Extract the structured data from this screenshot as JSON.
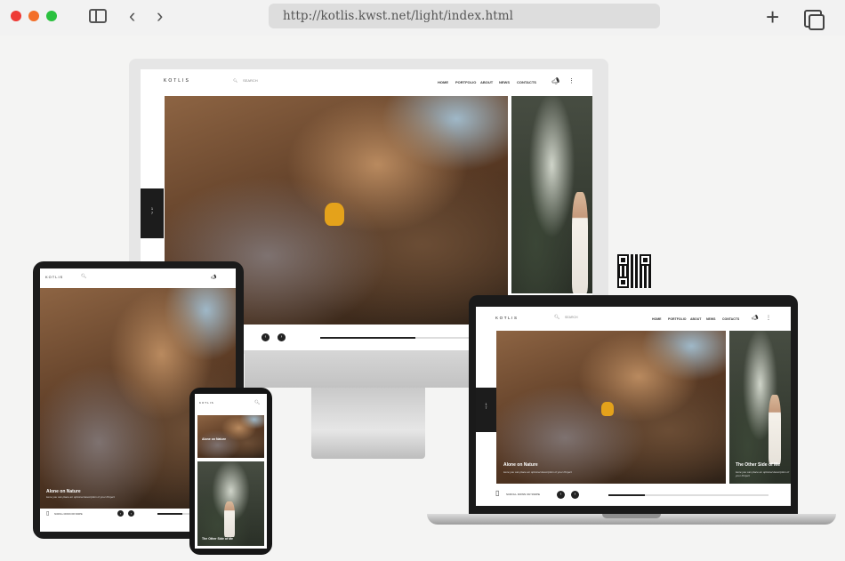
{
  "browser": {
    "url": "http://kotlis.kwst.net/light/index.html",
    "icons": {
      "sidebar": "sidebar-icon",
      "back": "chevron-left-icon",
      "forward": "chevron-right-icon",
      "new_tab": "plus-icon",
      "tabs": "tabs-icon"
    },
    "traffic_lights": [
      "#ee3b36",
      "#f36f28",
      "#2bc13f"
    ]
  },
  "site": {
    "logo": "KOTLIS",
    "search_placeholder": "SEARCH",
    "nav": [
      "HOME",
      "PORTFOLIO",
      "ABOUT",
      "NEWS",
      "CONTACTS"
    ],
    "slide_counter_current": "1",
    "slide_counter_total": "7",
    "slides": [
      {
        "title": "Alone on Nature",
        "subtitle": "Here you can place an optional description of your Project"
      },
      {
        "title": "The Other Side of Me",
        "subtitle": "Here you can place an optional description of your Project"
      }
    ],
    "scroll_label": "SCROLL DOWN OR SWIPE",
    "progress": 0.35,
    "caption_fragment": "Project"
  }
}
